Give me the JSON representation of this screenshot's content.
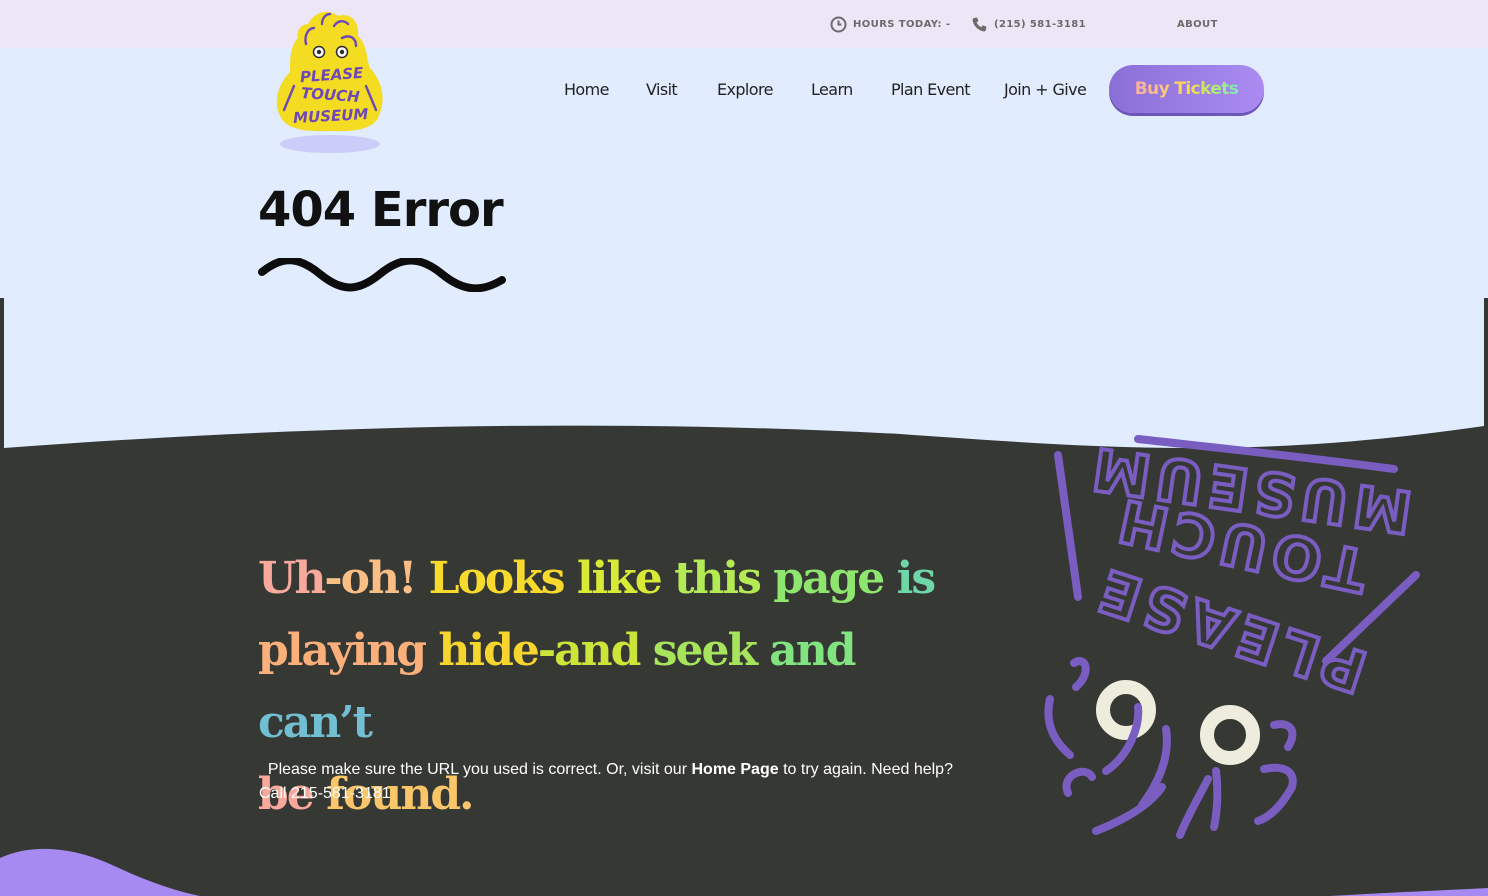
{
  "topbar": {
    "hours_label": "HOURS TODAY: -",
    "phone_label": "(215) 581-3181",
    "about_label": "ABOUT"
  },
  "logo": {
    "line1": "PLEASE",
    "line2": "TOUCH",
    "line3": "MUSEUM"
  },
  "nav": {
    "items": [
      {
        "label": "Home"
      },
      {
        "label": "Visit"
      },
      {
        "label": "Explore"
      },
      {
        "label": "Learn"
      },
      {
        "label": "Plan Event"
      },
      {
        "label": "Join + Give"
      }
    ],
    "cta_label": "Buy Tickets"
  },
  "hero": {
    "title": "404 Error"
  },
  "error": {
    "headline_words": [
      "Uh",
      "-oh!",
      "Looks",
      "like",
      "this",
      "page",
      "is",
      "playing",
      "hide",
      "-and",
      "seek",
      "and",
      "can’t",
      "be",
      "found."
    ],
    "message_prefix": "Please make sure the URL you used is correct. Or, visit our",
    "home_link": "Home Page",
    "message_suffix": "to try again. Need help? Call 215-581-3181"
  },
  "mascot": {
    "line1": "PLEASE",
    "line2": "TOUCH",
    "line3": "MUSEUM"
  },
  "colors": {
    "top_bar_bg": "#ece6f6",
    "page_bg": "#e1ecfe",
    "dark_section_bg": "#363834",
    "accent_purple": "#7a5dc0",
    "logo_yellow": "#f4dc22",
    "bottom_wave": "#a68af2"
  }
}
